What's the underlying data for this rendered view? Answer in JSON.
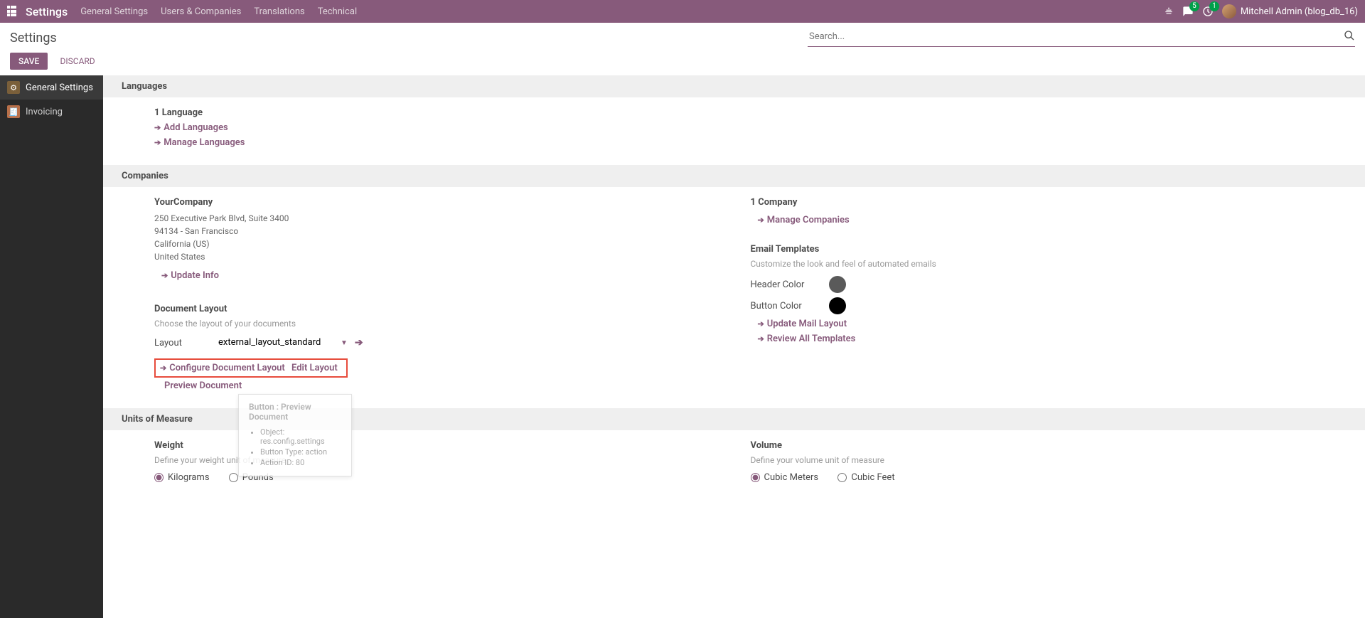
{
  "nav": {
    "app_title": "Settings",
    "items": [
      "General Settings",
      "Users & Companies",
      "Translations",
      "Technical"
    ],
    "messages_badge": "5",
    "activities_badge": "1",
    "user": "Mitchell Admin (blog_db_16)"
  },
  "header": {
    "page_title": "Settings",
    "search_placeholder": "Search...",
    "save": "SAVE",
    "discard": "DISCARD"
  },
  "sidebar": {
    "items": [
      {
        "label": "General Settings",
        "active": true
      },
      {
        "label": "Invoicing",
        "active": false
      }
    ]
  },
  "languages": {
    "section": "Languages",
    "count": "1 Language",
    "add": "Add Languages",
    "manage": "Manage Languages"
  },
  "companies": {
    "section": "Companies",
    "company_name": "YourCompany",
    "addr1": "250 Executive Park Blvd, Suite 3400",
    "addr2": "94134 - San Francisco",
    "addr3": "California (US)",
    "addr4": "United States",
    "update_info": "Update Info",
    "count": "1 Company",
    "manage": "Manage Companies",
    "doc_layout_title": "Document Layout",
    "doc_layout_desc": "Choose the layout of your documents",
    "layout_label": "Layout",
    "layout_value": "external_layout_standard",
    "configure": "Configure Document Layout",
    "edit": "Edit Layout",
    "preview": "Preview Document",
    "email_title": "Email Templates",
    "email_desc": "Customize the look and feel of automated emails",
    "header_color_label": "Header Color",
    "header_color": "#5a5a5a",
    "button_color_label": "Button Color",
    "button_color": "#000000",
    "update_mail": "Update Mail Layout",
    "review_templates": "Review All Templates"
  },
  "units": {
    "section": "Units of Measure",
    "weight_title": "Weight",
    "weight_desc": "Define your weight unit of measure",
    "kg": "Kilograms",
    "lb": "Pounds",
    "volume_title": "Volume",
    "volume_desc": "Define your volume unit of measure",
    "m3": "Cubic Meters",
    "ft3": "Cubic Feet"
  },
  "tooltip": {
    "title": "Button : Preview Document",
    "object_label": "Object:",
    "object": "res.config.settings",
    "type_label": "Button Type:",
    "type": "action",
    "action_label": "Action ID:",
    "action": "80"
  }
}
